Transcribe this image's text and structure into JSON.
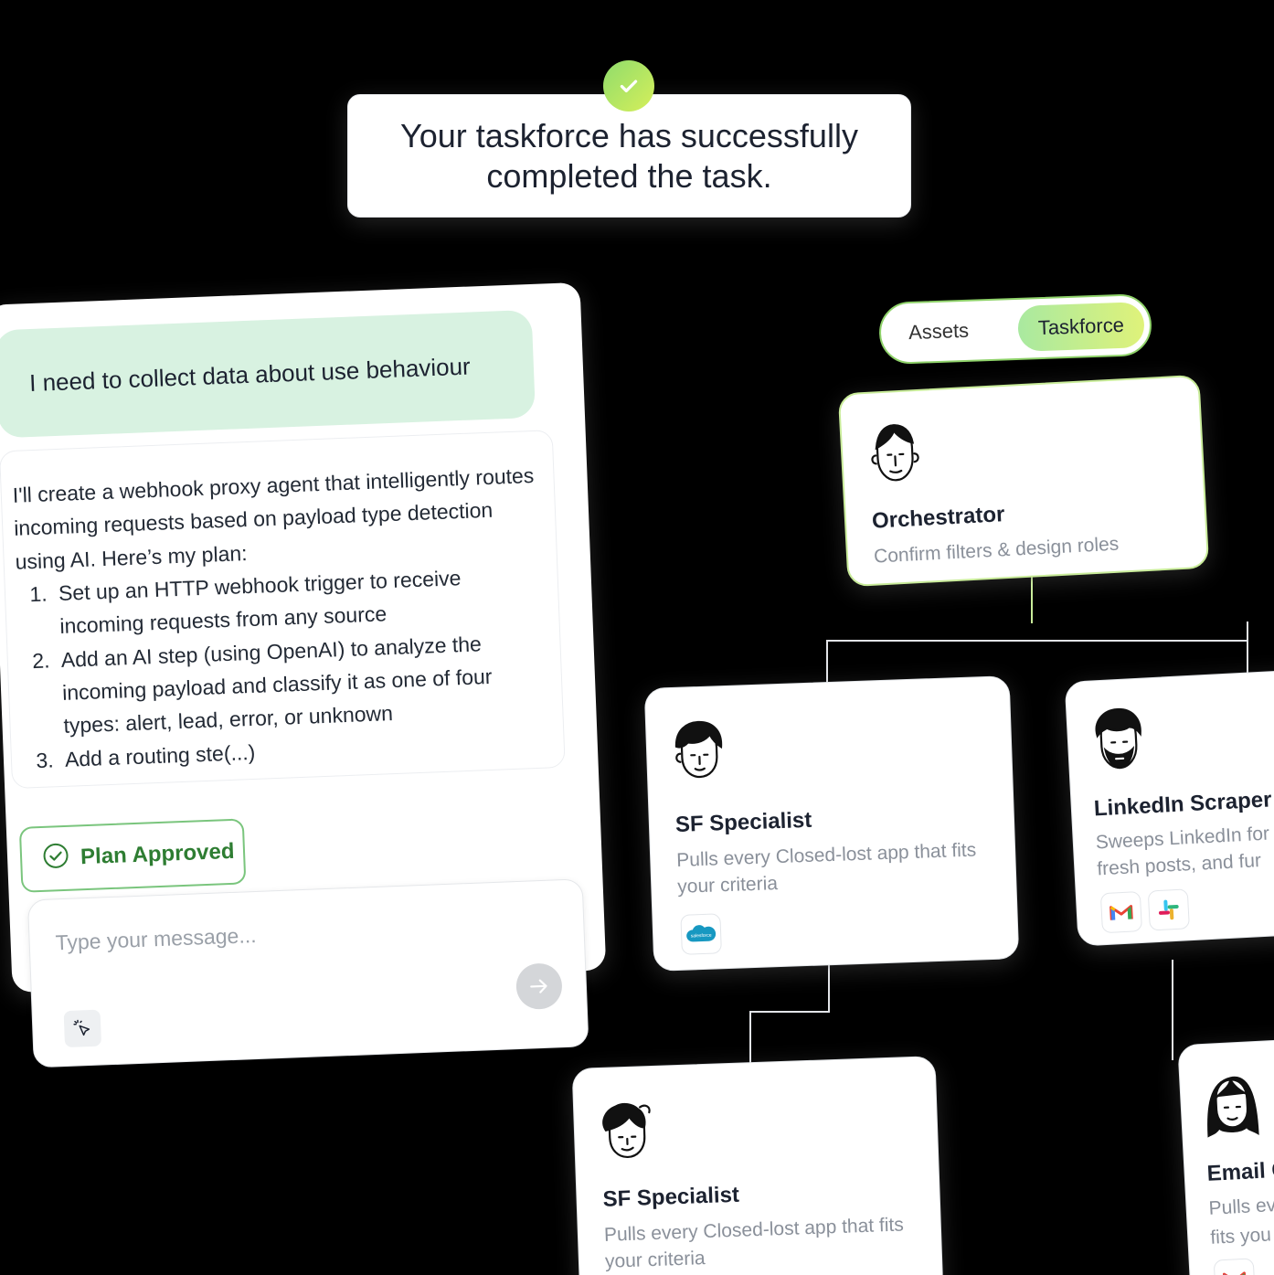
{
  "toast": {
    "message": "Your taskforce has successfully completed the task."
  },
  "chat": {
    "user_message": "I need to collect data about use behaviour",
    "ai_intro": "I'll create a webhook proxy agent that intelligently routes incoming requests based on payload type detection using AI. Here’s my plan:",
    "ai_steps": [
      "Set up an HTTP webhook trigger to receive incoming requests from any source",
      "Add an AI step (using OpenAI) to analyze the incoming payload and classify it as one of four types: alert, lead, error, or unknown",
      "Add a routing ste(...)"
    ],
    "approved_label": "Plan Approved",
    "input_placeholder": "Type your message..."
  },
  "tabs": {
    "assets": "Assets",
    "taskforce": "Taskforce",
    "active": "taskforce"
  },
  "agents": {
    "orchestrator": {
      "title": "Orchestrator",
      "desc": "Confirm filters & design roles"
    },
    "sf_specialist_1": {
      "title": "SF Specialist",
      "desc": "Pulls every Closed-lost app that fits your criteria",
      "tools": [
        "salesforce-icon"
      ]
    },
    "linkedin_scraper": {
      "title": "LinkedIn Scraper",
      "desc_line1": "Sweeps LinkedIn for",
      "desc_line2": "fresh posts, and fur",
      "tools": [
        "gmail-icon",
        "slack-icon"
      ]
    },
    "sf_specialist_2": {
      "title": "SF Specialist",
      "desc": "Pulls every Closed-lost app that fits your criteria"
    },
    "email": {
      "title": "Email C",
      "desc_line1": "Pulls ev",
      "desc_line2": "fits you",
      "tools": [
        "gmail-icon"
      ]
    }
  },
  "tool_labels": {
    "salesforce": "salesforce"
  },
  "colors": {
    "accent_green": "#7ac57d",
    "bubble_green": "#d8f2e1",
    "gradient_start": "#a9e9a0",
    "gradient_end": "#dff27a"
  }
}
